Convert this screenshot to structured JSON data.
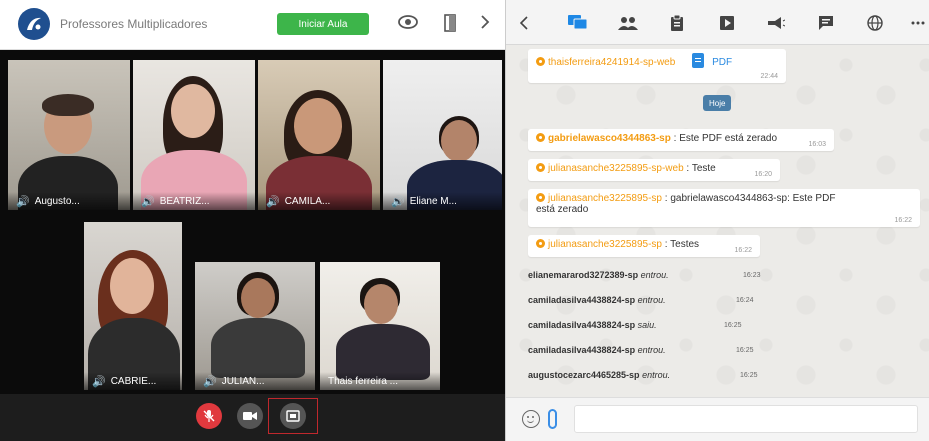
{
  "conference": {
    "title": "Professores Multiplicadores",
    "start_button": "Iniciar Aula",
    "participants": [
      {
        "name": "Augusto..."
      },
      {
        "name": "BEATRIZ..."
      },
      {
        "name": "CAMILA..."
      },
      {
        "name": "Eliane M..."
      },
      {
        "name": "CABRIE..."
      },
      {
        "name": "JULIAN..."
      },
      {
        "name": "Thais ferreira ..."
      }
    ]
  },
  "chat": {
    "messages": [
      {
        "user": "thaisferreira4241914-sp-web",
        "text": "PDF",
        "time": "22:44"
      },
      {
        "user": "gabrielawasco4344863-sp",
        "text": "Este PDF está zerado",
        "time": "16:03"
      },
      {
        "user": "julianasanche3225895-sp-web",
        "text": "Teste",
        "time": "16:20"
      },
      {
        "user": "julianasanche3225895-sp",
        "text": "gabrielawasco4344863-sp: Este PDF",
        "text2": "está zerado",
        "time": "16:22"
      },
      {
        "user": "julianasanche3225895-sp",
        "text": "Testes",
        "time": "16:22"
      }
    ],
    "today_label": "Hoje",
    "events": [
      {
        "user": "elianemararod3272389-sp",
        "action": "entrou.",
        "time": "16:23"
      },
      {
        "user": "camiladasilva4438824-sp",
        "action": "entrou.",
        "time": "16:24"
      },
      {
        "user": "camiladasilva4438824-sp",
        "action": "saiu.",
        "time": "16:25"
      },
      {
        "user": "camiladasilva4438824-sp",
        "action": "entrou.",
        "time": "16:25"
      },
      {
        "user": "augustocezarc4465285-sp",
        "action": "entrou.",
        "time": "16:25"
      }
    ],
    "input_placeholder": ""
  },
  "colors": {
    "accent": "#1e88e5",
    "start_green": "#3db54a",
    "user_orange": "#f39c12",
    "mic_red": "#e0393e"
  }
}
